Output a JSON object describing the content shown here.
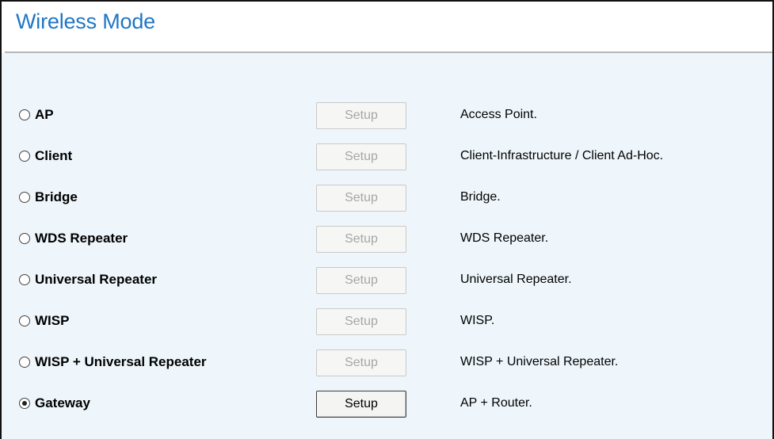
{
  "page": {
    "title": "Wireless Mode"
  },
  "modes": [
    {
      "label": "AP",
      "button_label": "Setup",
      "button_enabled": false,
      "description": "Access Point.",
      "selected": false
    },
    {
      "label": "Client",
      "button_label": "Setup",
      "button_enabled": false,
      "description": "Client-Infrastructure / Client Ad-Hoc.",
      "selected": false
    },
    {
      "label": "Bridge",
      "button_label": "Setup",
      "button_enabled": false,
      "description": "Bridge.",
      "selected": false
    },
    {
      "label": "WDS Repeater",
      "button_label": "Setup",
      "button_enabled": false,
      "description": "WDS Repeater.",
      "selected": false
    },
    {
      "label": "Universal Repeater",
      "button_label": "Setup",
      "button_enabled": false,
      "description": "Universal Repeater.",
      "selected": false
    },
    {
      "label": "WISP",
      "button_label": "Setup",
      "button_enabled": false,
      "description": "WISP.",
      "selected": false
    },
    {
      "label": "WISP + Universal Repeater",
      "button_label": "Setup",
      "button_enabled": false,
      "description": "WISP + Universal Repeater.",
      "selected": false
    },
    {
      "label": "Gateway",
      "button_label": "Setup",
      "button_enabled": true,
      "description": "AP + Router.",
      "selected": true
    }
  ],
  "colors": {
    "title": "#1e77c6",
    "content_background": "#eef6fb",
    "disabled_text": "#a6a6a6"
  }
}
